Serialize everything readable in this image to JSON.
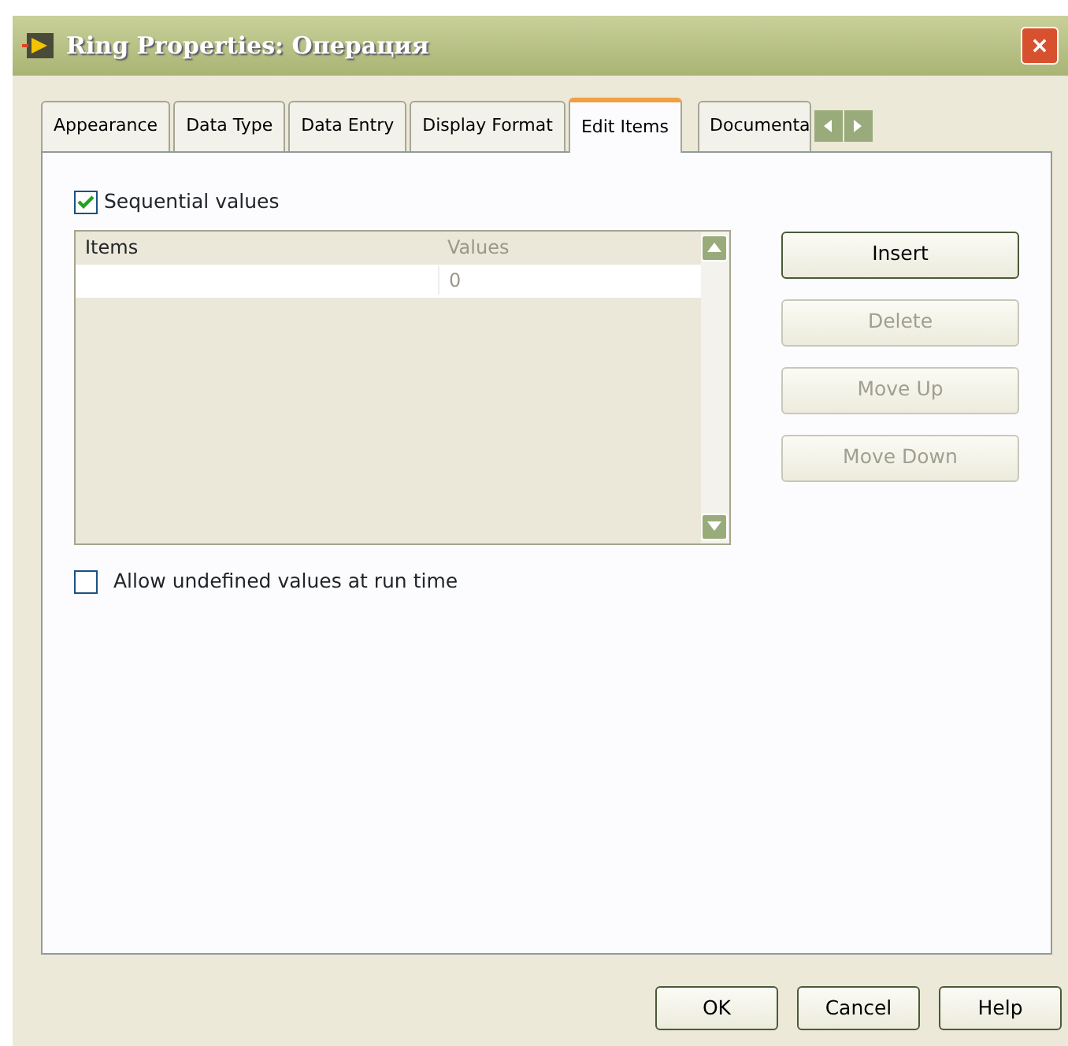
{
  "window": {
    "title": "Ring Properties: Операция"
  },
  "tabs": [
    {
      "label": "Appearance",
      "selected": false
    },
    {
      "label": "Data Type",
      "selected": false
    },
    {
      "label": "Data Entry",
      "selected": false
    },
    {
      "label": "Display Format",
      "selected": false
    },
    {
      "label": "Edit Items",
      "selected": true
    },
    {
      "label": "Documenta",
      "selected": false
    }
  ],
  "sequential_values": {
    "label": "Sequential values",
    "checked": true
  },
  "table": {
    "columns": [
      "Items",
      "Values"
    ],
    "rows": [
      {
        "value": "0"
      }
    ]
  },
  "side_buttons": [
    {
      "label": "Insert",
      "disabled": false
    },
    {
      "label": "Delete",
      "disabled": true
    },
    {
      "label": "Move Up",
      "disabled": true
    },
    {
      "label": "Move Down",
      "disabled": true
    }
  ],
  "allow_undefined": {
    "label": "Allow undefined values at run time",
    "checked": false
  },
  "buttons": [
    "OK",
    "Cancel",
    "Help"
  ]
}
